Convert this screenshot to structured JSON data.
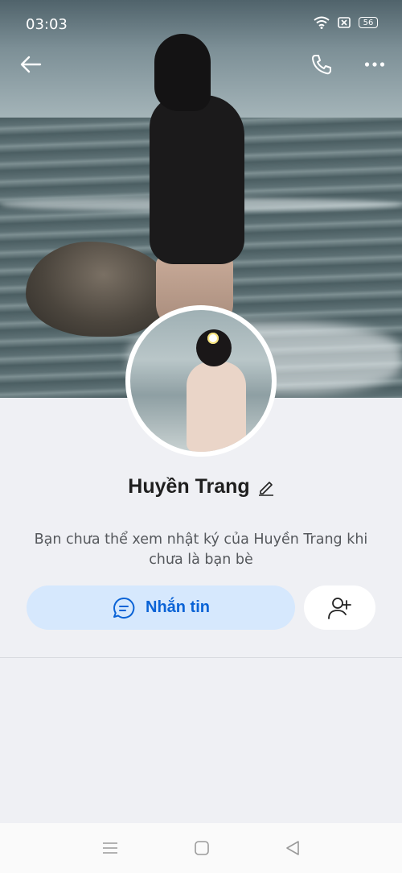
{
  "status_bar": {
    "time": "03:03",
    "battery": "56"
  },
  "icons": {
    "back": "arrow-left-icon",
    "call": "phone-icon",
    "more": "more-horizontal-icon",
    "edit": "pencil-icon",
    "chat": "chat-bubble-icon",
    "add_friend": "add-user-icon"
  },
  "profile": {
    "name": "Huyền Trang",
    "notice": "Bạn chưa thể xem nhật ký của Huyền Trang khi chưa là bạn bè"
  },
  "actions": {
    "message_label": "Nhắn tin"
  },
  "colors": {
    "accent": "#0a63d6",
    "message_button_bg": "#d6e8fd",
    "page_bg": "#eff0f4"
  }
}
